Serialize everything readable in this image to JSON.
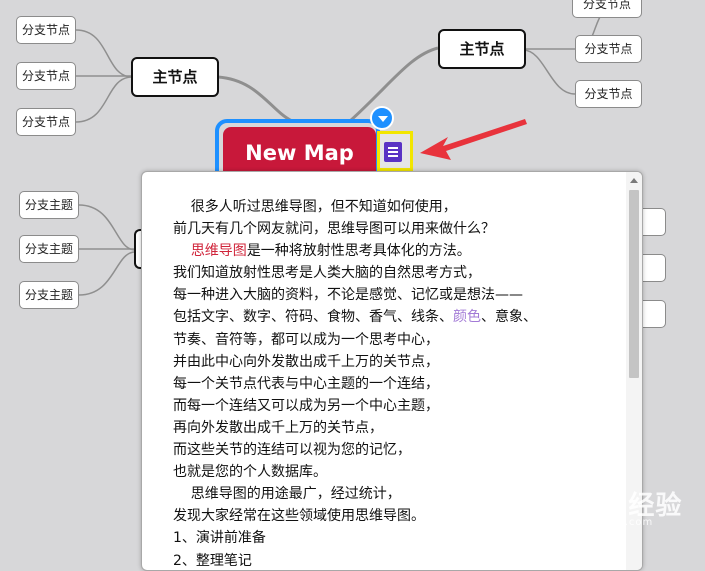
{
  "root": {
    "label": "New Map"
  },
  "left_top": {
    "main": "主节点",
    "branches": [
      "分支节点",
      "分支节点",
      "分支节点"
    ]
  },
  "left_bottom": {
    "branches": [
      "分支主题",
      "分支主题",
      "分支主题"
    ]
  },
  "right_top": {
    "main": "主节点",
    "branches": [
      "分支节点",
      "分支节点",
      "分支节点"
    ]
  },
  "note": {
    "lines": [
      [
        {
          "t": "    很多人听过思维导图，但不知道如何使用，"
        }
      ],
      [
        {
          "t": "前几天有几个网友就问，思维导图可以用来做什么？"
        }
      ],
      [
        {
          "t": "    "
        },
        {
          "t": "思维导图",
          "c": "red"
        },
        {
          "t": "是一种将放射性思考具体化的方法。"
        }
      ],
      [
        {
          "t": "我们知道放射性思考是人类大脑的自然思考方式，"
        }
      ],
      [
        {
          "t": "每一种进入大脑的资料，不论是感觉、记忆或是想法——"
        }
      ],
      [
        {
          "t": "包括文字、数字、符码、食物、香气、线条、"
        },
        {
          "t": "颜色",
          "c": "purple"
        },
        {
          "t": "、意象、"
        }
      ],
      [
        {
          "t": "节奏、音符等，都可以成为一个思考中心，"
        }
      ],
      [
        {
          "t": "并由此中心向外发散出成千上万的关节点，"
        }
      ],
      [
        {
          "t": "每一个关节点代表与中心主题的一个连结，"
        }
      ],
      [
        {
          "t": "而每一个连结又可以成为另一个中心主题，"
        }
      ],
      [
        {
          "t": "再向外发散出成千上万的关节点，"
        }
      ],
      [
        {
          "t": "而这些关节的连结可以视为您的记忆，"
        }
      ],
      [
        {
          "t": "也就是您的个人数据库。"
        }
      ],
      [
        {
          "t": "    思维导图的用途最广，经过统计，"
        }
      ],
      [
        {
          "t": "发现大家经常在这些领域使用思维导图。"
        }
      ],
      [
        {
          "t": "1、演讲前准备"
        }
      ],
      [
        {
          "t": "2、整理笔记"
        }
      ]
    ]
  },
  "watermark": {
    "logo": "Baidu经验",
    "url": "jingyan.baidu.com"
  },
  "colors": {
    "background": "#d7d7d9",
    "root_fill": "#c8183a",
    "root_selection": "#1e90ff",
    "note_highlight": "#f2e600",
    "note_icon": "#5a33c4",
    "arrow": "#e8333c"
  }
}
